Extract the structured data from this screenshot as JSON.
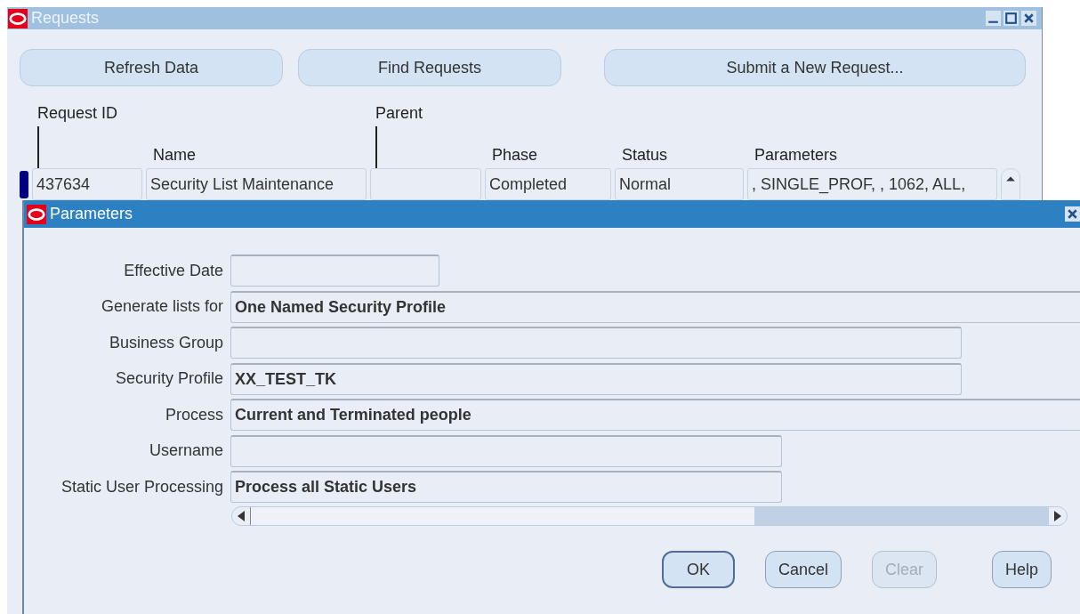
{
  "window": {
    "title": "Requests"
  },
  "toolbar_buttons": [
    {
      "label": "Refresh Data"
    },
    {
      "label": "Find Requests"
    },
    {
      "label": "Submit a New Request..."
    }
  ],
  "table": {
    "columns": [
      {
        "label": "Request ID",
        "kind": "upper"
      },
      {
        "label": "Name",
        "kind": "lower"
      },
      {
        "label": "Parent",
        "kind": "upper"
      },
      {
        "label": "Phase",
        "kind": "lower"
      },
      {
        "label": "Status",
        "kind": "lower"
      },
      {
        "label": "Parameters",
        "kind": "lower"
      }
    ],
    "rows": [
      {
        "selected": true,
        "cells": [
          "437634",
          "Security List Maintenance",
          null,
          "Completed",
          "Normal",
          ", SINGLE_PROF, , 1062, ALL,"
        ]
      }
    ]
  },
  "dialog": {
    "title": "Parameters",
    "fields": [
      {
        "label": "Effective Date"
      },
      {
        "label": "Generate lists for",
        "value": "One Named Security Profile"
      },
      {
        "label": "Business Group"
      },
      {
        "label": "Security Profile",
        "value": "XX_TEST_TK"
      },
      {
        "label": "Process",
        "value": "Current and Terminated people"
      },
      {
        "label": "Username"
      },
      {
        "label": "Static User Processing",
        "value": "Process all Static Users"
      }
    ],
    "buttons": [
      {
        "label": "OK",
        "default": true,
        "disabled": false
      },
      {
        "label": "Cancel",
        "default": false,
        "disabled": false
      },
      {
        "label": "Clear",
        "default": false,
        "disabled": true
      },
      {
        "label": "Help",
        "default": false,
        "disabled": false
      }
    ]
  }
}
